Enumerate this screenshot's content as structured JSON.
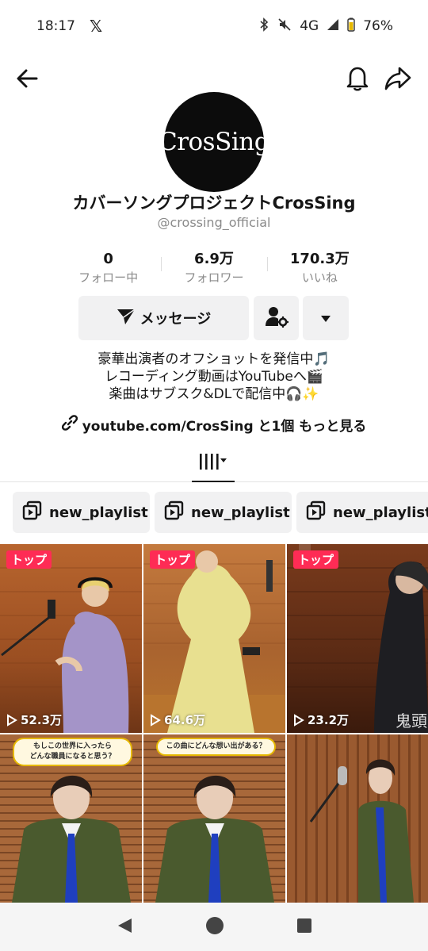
{
  "status_bar": {
    "time": "18:17",
    "network": "4G",
    "battery": "76%"
  },
  "profile": {
    "avatar_text": "CrosSing",
    "name": "カバーソングプロジェクトCrosSing",
    "handle": "@crossing_official"
  },
  "stats": [
    {
      "value": "0",
      "label": "フォロー中"
    },
    {
      "value": "6.9万",
      "label": "フォロワー"
    },
    {
      "value": "170.3万",
      "label": "いいね"
    }
  ],
  "actions": {
    "message_label": "メッセージ"
  },
  "bio": {
    "line1": "豪華出演者のオフショットを発信中🎵",
    "line2": "レコーディング動画はYouTubeへ🎬",
    "line3": "楽曲はサブスク&DLで配信中🎧✨"
  },
  "link": {
    "text": "youtube.com/CrosSing と1個 もっと見る"
  },
  "playlists": [
    {
      "label": "new_playlist"
    },
    {
      "label": "new_playlist"
    },
    {
      "label": "new_playlist"
    }
  ],
  "videos": [
    {
      "badge": "トップ",
      "views": "52.3万"
    },
    {
      "badge": "トップ",
      "views": "64.6万"
    },
    {
      "badge": "トップ",
      "views": "23.2万",
      "overlay_text": "鬼頭"
    },
    {
      "caption_line1": "もしこの世界に入ったら",
      "caption_line2": "どんな職員になると思う？"
    },
    {
      "caption_line1": "この曲にどんな想い出がある？"
    },
    {}
  ],
  "colors": {
    "accent_badge": "#fe2c55",
    "button_bg": "#f1f1f2",
    "text_secondary": "#8a8a8a"
  }
}
